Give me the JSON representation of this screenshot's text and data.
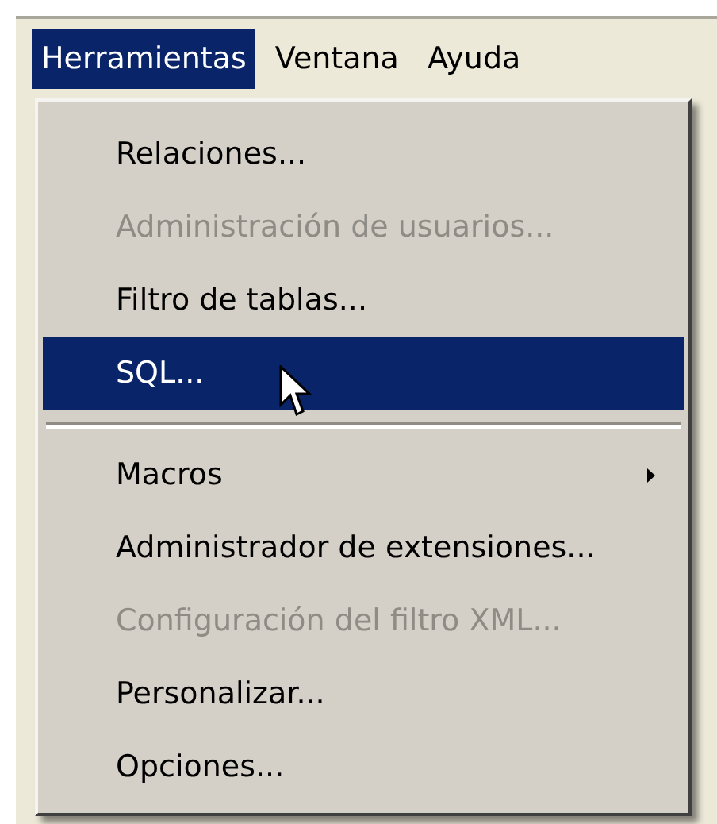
{
  "menubar": [
    {
      "label": "Herramientas",
      "selected": true
    },
    {
      "label": "Ventana",
      "selected": false
    },
    {
      "label": "Ayuda",
      "selected": false
    }
  ],
  "menu": {
    "items": [
      {
        "kind": "item",
        "label": "Relaciones...",
        "disabled": false,
        "selected": false
      },
      {
        "kind": "item",
        "label": "Administración de usuarios...",
        "disabled": true,
        "selected": false
      },
      {
        "kind": "item",
        "label": "Filtro de tablas...",
        "disabled": false,
        "selected": false
      },
      {
        "kind": "item",
        "label": "SQL...",
        "disabled": false,
        "selected": true
      },
      {
        "kind": "separator"
      },
      {
        "kind": "submenu",
        "label": "Macros",
        "disabled": false,
        "selected": false
      },
      {
        "kind": "item",
        "label": "Administrador de extensiones...",
        "disabled": false,
        "selected": false
      },
      {
        "kind": "item",
        "label": "Configuración del filtro XML...",
        "disabled": true,
        "selected": false
      },
      {
        "kind": "item",
        "label": "Personalizar...",
        "disabled": false,
        "selected": false
      },
      {
        "kind": "item",
        "label": "Opciones...",
        "disabled": false,
        "selected": false
      }
    ]
  }
}
